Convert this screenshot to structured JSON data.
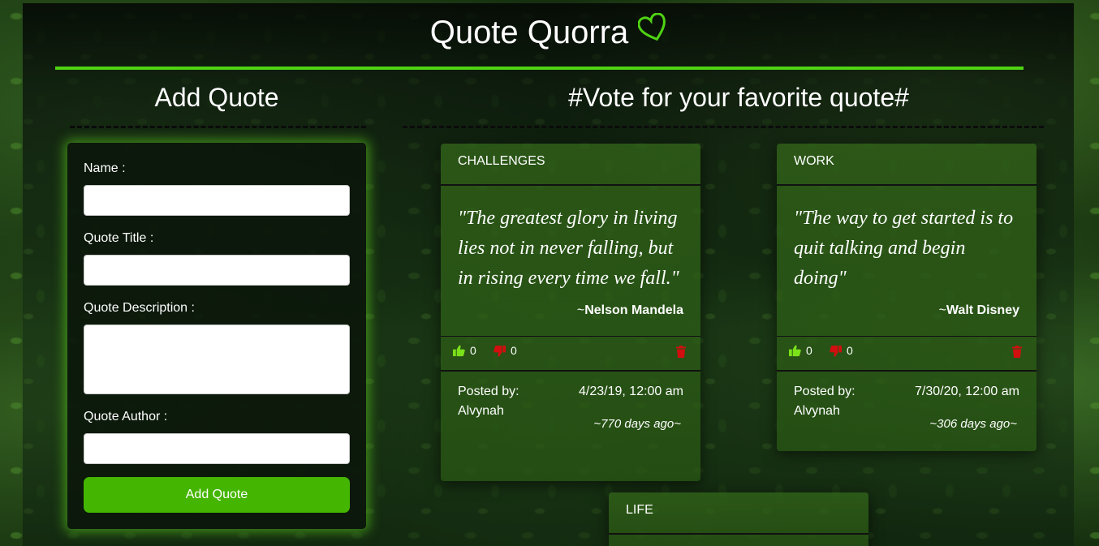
{
  "app": {
    "title": "Quote Quorra",
    "accent": "#4fd313"
  },
  "form": {
    "heading": "Add Quote",
    "name_label": "Name :",
    "title_label": "Quote Title :",
    "description_label": "Quote Description :",
    "author_label": "Quote Author :",
    "submit_label": "Add Quote",
    "name_value": "",
    "title_value": "",
    "description_value": "",
    "author_value": ""
  },
  "vote_section": {
    "heading": "#Vote for your favorite quote#"
  },
  "quotes": [
    {
      "category": "CHALLENGES",
      "text": "\"The greatest glory in living lies not in never falling, but in rising every time we fall.\"",
      "author_prefix": "~",
      "author": "Nelson Mandela",
      "upvotes": "0",
      "downvotes": "0",
      "posted_label": "Posted by:",
      "posted_by": "Alvynah",
      "date": "4/23/19, 12:00 am",
      "ago": "~770 days ago~"
    },
    {
      "category": "WORK",
      "text": "\"The way to get started is to quit talking and begin doing\"",
      "author_prefix": "~",
      "author": "Walt Disney",
      "upvotes": "0",
      "downvotes": "0",
      "posted_label": "Posted by:",
      "posted_by": "Alvynah",
      "date": "7/30/20, 12:00 am",
      "ago": "~306 days ago~"
    },
    {
      "category": "LIFE"
    }
  ],
  "colors": {
    "thumbs_up": "#7ae01a",
    "thumbs_down": "#d10f0f",
    "trash": "#d10f0f",
    "button": "#44b500"
  }
}
